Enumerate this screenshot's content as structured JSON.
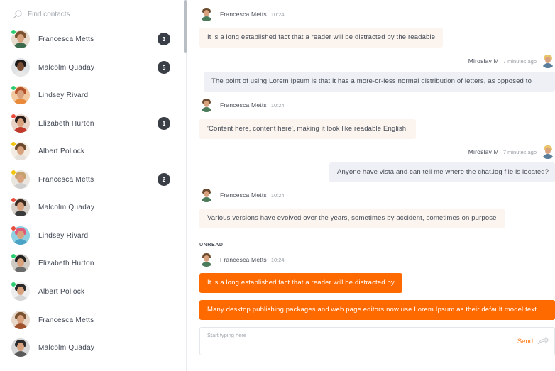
{
  "search": {
    "placeholder": "Find contacts"
  },
  "contacts": [
    {
      "name": "Francesca Metts",
      "status": "#2ecc71",
      "badge": "3",
      "hair": "#7a5230",
      "body": "#3d6b4d"
    },
    {
      "name": "Malcolm Quaday",
      "status": "",
      "badge": "5",
      "hair": "#1f1a17",
      "body": "#e8e8e8"
    },
    {
      "name": "Lindsey Rivard",
      "status": "#2ecc71",
      "badge": "",
      "hair": "#b4532a",
      "body": "#e98a3a"
    },
    {
      "name": "Elizabeth Hurton",
      "status": "#e74c3c",
      "badge": "1",
      "hair": "#2a1e1a",
      "body": "#c0392b"
    },
    {
      "name": "Albert Pollock",
      "status": "#f1c40f",
      "badge": "",
      "hair": "#6b4a2d",
      "body": "#e6e1da"
    },
    {
      "name": "Francesca Metts",
      "status": "#f1c40f",
      "badge": "2",
      "hair": "#c6a16d",
      "body": "#cfcfcf"
    },
    {
      "name": "Malcolm Quaday",
      "status": "#e74c3c",
      "badge": "",
      "hair": "#3a2a20",
      "body": "#3b3b3b"
    },
    {
      "name": "Lindsey Rivard",
      "status": "#e74c3c",
      "badge": "",
      "hair": "#e05a7a",
      "body": "#4aa3c4"
    },
    {
      "name": "Elizabeth Hurton",
      "status": "#2ecc71",
      "badge": "",
      "hair": "#222222",
      "body": "#6b6b6b"
    },
    {
      "name": "Albert Pollock",
      "status": "#2ecc71",
      "badge": "",
      "hair": "#2b2b2b",
      "body": "#d5d5d5"
    },
    {
      "name": "Francesca Metts",
      "status": "",
      "badge": "",
      "hair": "#7a5230",
      "body": "#a0522d"
    },
    {
      "name": "Malcolm Quaday",
      "status": "",
      "badge": "",
      "hair": "#2b2b2b",
      "body": "#5a5a5a"
    }
  ],
  "messages": [
    {
      "sender": "Francesca Metts",
      "time": "10:24",
      "text": "It is a long established fact that a reader will be distracted by the readable"
    },
    {
      "sender": "Miroslav M",
      "time": "7 minutes ago",
      "text": "The point of using Lorem Ipsum is that it has a more-or-less normal distribution of letters, as opposed to"
    },
    {
      "sender": "Francesca Metts",
      "time": "10:24",
      "text": "'Content here, content here', making it look like readable English."
    },
    {
      "sender": "Miroslav M",
      "time": "7 minutes ago",
      "text": "Anyone have vista and can tell me where the chat.log file is located?"
    },
    {
      "sender": "Francesca Metts",
      "time": "10:24",
      "text": "Various versions have evolved over the years, sometimes by accident, sometimes on purpose"
    },
    {
      "sender": "Francesca Metts",
      "time": "10:24",
      "text": "It is a long established fact that a reader will be distracted by"
    },
    {
      "text": "Many desktop publishing packages and web page editors now use Lorem Ipsum as their default model text."
    }
  ],
  "unread_label": "UNREAD",
  "composer": {
    "placeholder": "Start typing here",
    "send_label": "Send"
  },
  "colors": {
    "accent": "#ff6a00",
    "badge": "#3a3f47"
  }
}
